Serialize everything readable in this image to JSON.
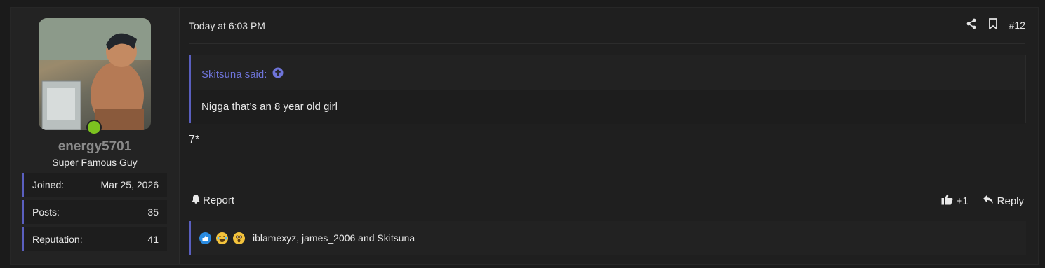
{
  "user": {
    "username": "energy5701",
    "title": "Super Famous Guy",
    "online": true,
    "stats": [
      {
        "label": "Joined:",
        "value": "Mar 25, 2026"
      },
      {
        "label": "Posts:",
        "value": "35"
      },
      {
        "label": "Reputation:",
        "value": "41"
      }
    ]
  },
  "post": {
    "date": "Today at 6:03 PM",
    "number": "#12",
    "quote": {
      "author_line": "Skitsuna said:",
      "text": "Nigga that’s an 8 year old girl"
    },
    "message": "7*",
    "report_label": "Report",
    "like_label": "+1",
    "reply_label": "Reply",
    "reactions": {
      "icons": [
        "like-icon",
        "laugh-icon",
        "wow-icon"
      ],
      "text": "iblamexyz, james_2006 and Skitsuna"
    }
  },
  "colors": {
    "accent": "#5a5fbf",
    "quote_link": "#6e74d9",
    "online": "#7cc21f",
    "background": "#1b1b1b"
  }
}
